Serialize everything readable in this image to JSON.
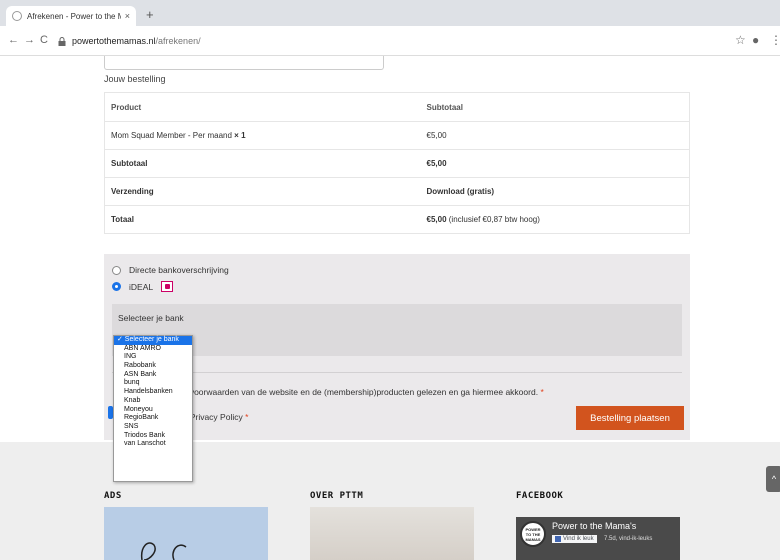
{
  "browser": {
    "tab_title": "Afrekenen - Power to the Mam",
    "tab_close": "×",
    "new_tab": "+",
    "back": "←",
    "forward": "→",
    "reload": "C",
    "url_host": "powertothemamas.nl",
    "url_path": "/afrekenen/",
    "star": "☆",
    "account": "●",
    "menu": "⋮"
  },
  "order": {
    "heading": "Jouw bestelling",
    "col_product": "Product",
    "col_subtotal": "Subtotaal",
    "item_name": "Mom Squad Member - Per maand",
    "item_qty": "× 1",
    "item_price": "€5,00",
    "subtotal_label": "Subtotaal",
    "subtotal_value": "€5,00",
    "shipping_label": "Verzending",
    "shipping_value": "Download (gratis)",
    "total_label": "Totaal",
    "total_value": "€5,00",
    "total_note": " (inclusief €0,87 btw hoog)"
  },
  "payment": {
    "method_bank": "Directe bankoverschrijving",
    "method_ideal": "iDEAL",
    "select_bank_label": "Selecteer je bank",
    "terms_text": "ne voorwaarden van de website en de (membership)producten gelezen en ga hiermee akkoord.",
    "privacy_text": "de Privacy Policy",
    "required_mark": "*",
    "place_order": "Bestelling plaatsen"
  },
  "dropdown": {
    "options": [
      "✓ Selecteer je bank",
      "ABN AMRO",
      "ING",
      "Rabobank",
      "ASN Bank",
      "bunq",
      "Handelsbanken",
      "Knab",
      "Moneyou",
      "RegioBank",
      "SNS",
      "Triodos Bank",
      "van Lanschot"
    ]
  },
  "footer": {
    "ads_title": "ADS",
    "pttm_title": "OVER PTTM",
    "facebook_title": "FACEBOOK",
    "fb_page_name": "Power to the Mama's",
    "fb_logo_line1": "POWER",
    "fb_logo_line2": "TO THE",
    "fb_logo_line3": "MAMAS",
    "fb_like": "Vind ik leuk",
    "fb_count": "7.5d, vind-ik-leuks",
    "scroll_top": "^"
  },
  "colors": {
    "accent_button": "#d2541e",
    "selection_blue": "#1a73e8",
    "payment_bg": "#ebe9eb"
  }
}
